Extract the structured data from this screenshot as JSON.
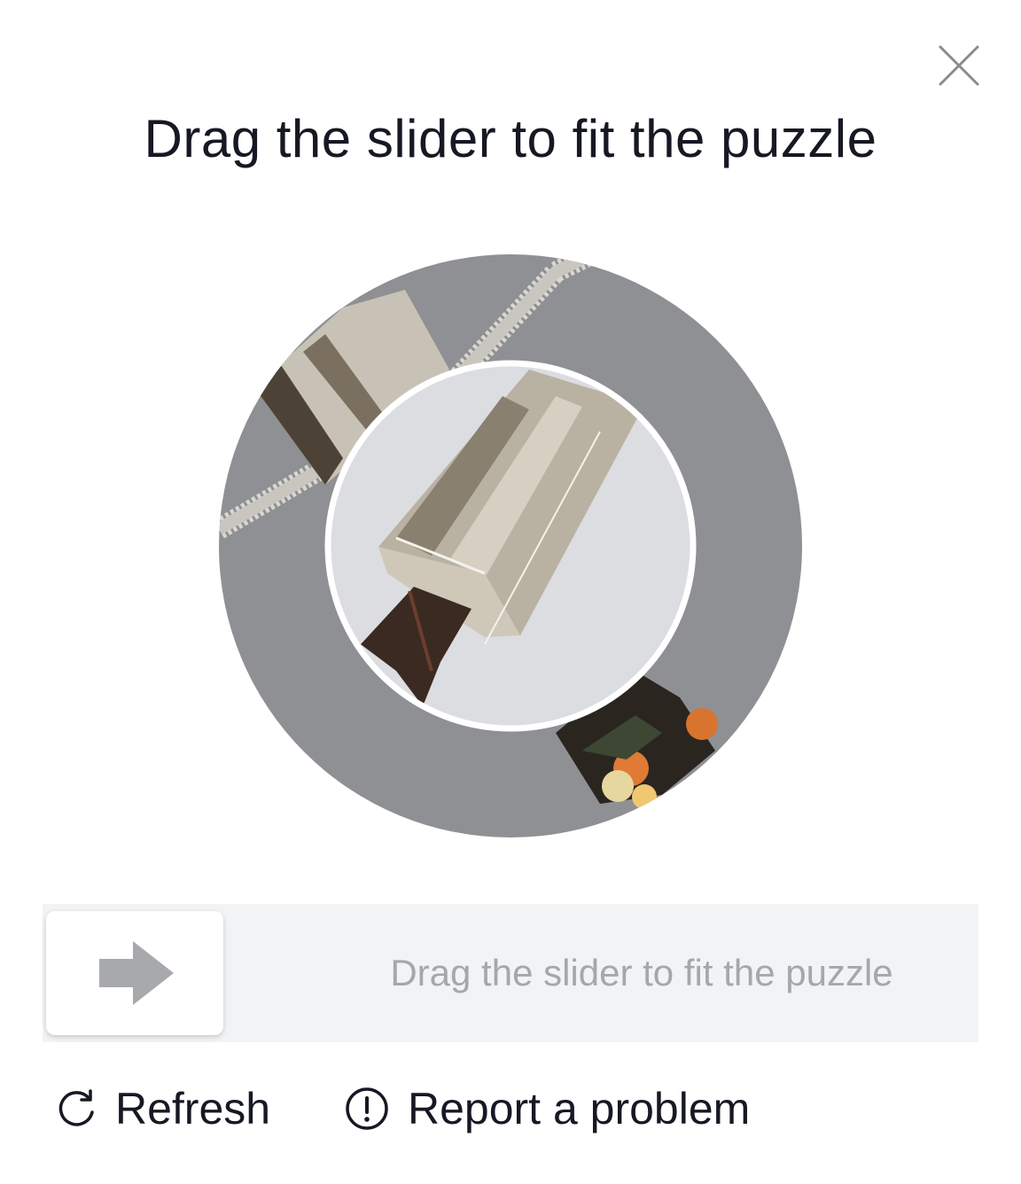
{
  "dialog": {
    "title": "Drag the slider to fit the puzzle",
    "close_icon": "close-icon"
  },
  "slider": {
    "hint": "Drag the slider to fit the puzzle",
    "handle_icon": "arrow-right-icon",
    "progress": 0
  },
  "footer": {
    "refresh_label": "Refresh",
    "refresh_icon": "refresh-icon",
    "report_label": "Report a problem",
    "report_icon": "exclamation-circle-icon"
  },
  "colors": {
    "title_text": "#161823",
    "hint_text": "#a6a7ab",
    "track_bg": "#f2f3f5",
    "outer_ring": "#8f9093",
    "inner_bg": "#dcdde0"
  }
}
